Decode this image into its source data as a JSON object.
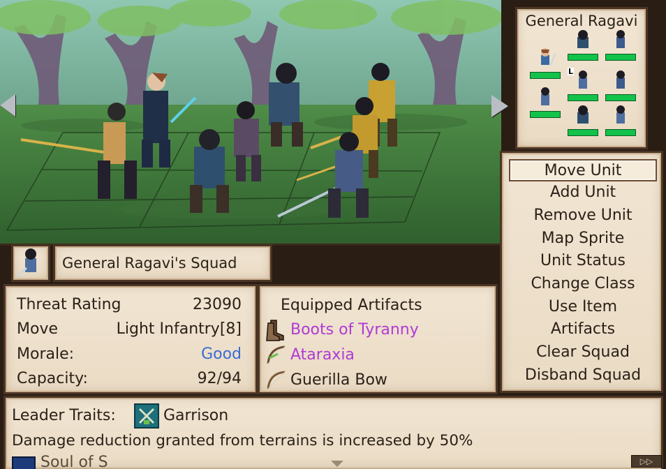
{
  "scene": {
    "units": 8
  },
  "roster": {
    "title": "General Ragavi",
    "leader_marker": "L",
    "slots": [
      {
        "sprite": "swordsman"
      },
      {
        "sprite": "hooded-rogue"
      },
      {
        "sprite": "archer"
      },
      {
        "sprite": "swordswoman"
      },
      {
        "sprite": "archer"
      },
      {
        "sprite": "swordswoman"
      },
      {
        "sprite": "hooded-rogue"
      },
      {
        "sprite": "swordswoman"
      }
    ]
  },
  "menu": {
    "items": [
      "Move Unit",
      "Add Unit",
      "Remove Unit",
      "Map Sprite",
      "Unit Status",
      "Change Class",
      "Use Item",
      "Artifacts",
      "Clear Squad",
      "Disband Squad"
    ],
    "selected_index": 0
  },
  "squad": {
    "name": "General Ragavi's Squad"
  },
  "stats": {
    "threat_label": "Threat Rating",
    "threat_value": "23090",
    "move_label": "Move",
    "move_value": "Light Infantry[8]",
    "morale_label": "Morale:",
    "morale_value": "Good",
    "capacity_label": "Capacity:",
    "capacity_value": "92/94"
  },
  "artifacts": {
    "title": "Equipped Artifacts",
    "items": [
      {
        "name": "Boots of Tyranny",
        "icon": "boots-icon",
        "rarity": "epic"
      },
      {
        "name": "Ataraxia",
        "icon": "bow-icon",
        "rarity": "epic"
      },
      {
        "name": "Guerilla Bow",
        "icon": "bow-icon",
        "rarity": "common"
      }
    ]
  },
  "traits": {
    "label": "Leader Traits:",
    "trait_name": "Garrison",
    "trait_icon": "garrison-icon",
    "description": "Damage reduction granted from terrains is increased by 50%",
    "next_trait_partial": "Soul of S"
  },
  "colors": {
    "good": "#3a6bd4",
    "epic": "#b13ad6",
    "hp_bar": "#13c24a"
  }
}
